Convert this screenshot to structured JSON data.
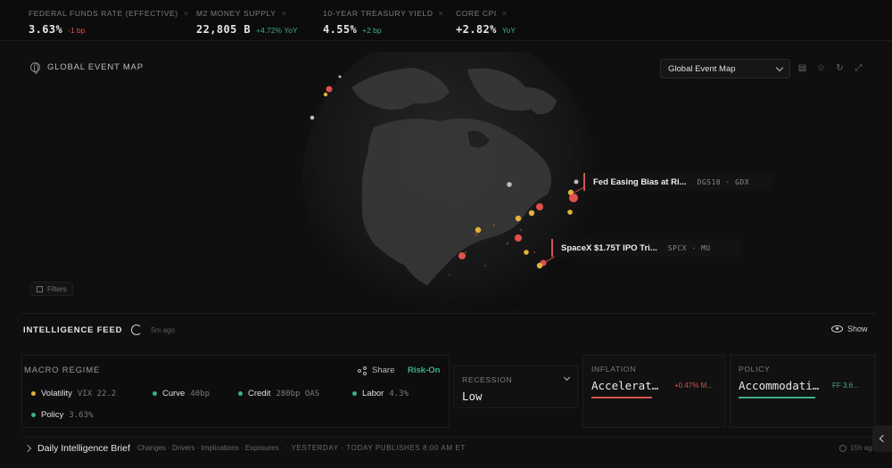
{
  "ticker": [
    {
      "label": "FEDERAL FUNDS RATE (EFFECTIVE)",
      "value": "3.63%",
      "change": "-1 bp",
      "direction": "down"
    },
    {
      "label": "M2 MONEY SUPPLY",
      "value": "22,805 B",
      "change": "+4.72% YoY",
      "direction": "up"
    },
    {
      "label": "10-YEAR TREASURY YIELD",
      "value": "4.55%",
      "change": "+2 bp",
      "direction": "up"
    },
    {
      "label": "CORE CPI",
      "value": "+2.82%",
      "change": "YoY",
      "direction": "up"
    }
  ],
  "ticker_close_glyph": "×",
  "map": {
    "title": "GLOBAL EVENT MAP",
    "select_value": "Global Event Map",
    "filters_label": "Filters",
    "icons": [
      "globe-icon",
      "filter-icon",
      "grid-icon",
      "star-icon",
      "refresh-icon",
      "expand-icon"
    ],
    "callouts": [
      {
        "title": "Fed Easing Bias at Ri...",
        "codes": "DGS10 · GDX"
      },
      {
        "title": "SpaceX $1.75T IPO Tri...",
        "codes": "SPCX · MU"
      }
    ],
    "marker_colors": {
      "high": "#e0504c",
      "medium": "#e5b13a",
      "low": "#bdbdbd"
    }
  },
  "feed": {
    "title": "INTELLIGENCE FEED",
    "updated": "5m ago",
    "show_label": "Show"
  },
  "macro": {
    "title": "MACRO REGIME",
    "share_label": "Share",
    "regime": "Risk-On",
    "indicators": [
      {
        "name": "Volatility",
        "value": "VIX 22.2",
        "color": "#e5b13a"
      },
      {
        "name": "Curve",
        "value": "40bp",
        "color": "#3fae8a"
      },
      {
        "name": "Credit",
        "value": "280bp OAS",
        "color": "#3fae8a"
      },
      {
        "name": "Labor",
        "value": "4.3%",
        "color": "#3fae8a"
      },
      {
        "name": "Policy",
        "value": "3.63%",
        "color": "#3fae8a"
      }
    ]
  },
  "cards": {
    "recession": {
      "title": "RECESSION",
      "value": "Low"
    },
    "inflation": {
      "title": "INFLATION",
      "value": "Accelerat…",
      "delta": "+0.47% M...",
      "color": "#d2554f"
    },
    "policy": {
      "title": "POLICY",
      "value": "Accommodati…",
      "delta": "FF 3.6...",
      "color": "#3fae8a"
    }
  },
  "brief": {
    "title": "Daily Intelligence Brief",
    "sections": "Changes · Drivers · Implications · Exposures",
    "schedule": "· YESTERDAY · TODAY PUBLISHES 8:00 AM ET",
    "time": "15h ago"
  }
}
